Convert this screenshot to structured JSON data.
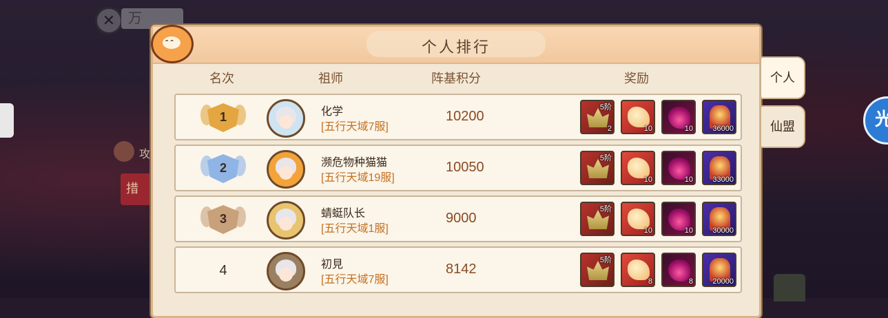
{
  "background": {
    "tab_label": "万",
    "attack_label": "攻",
    "red_button_label": "措",
    "badge_text": "光环"
  },
  "panel": {
    "title": "个人排行"
  },
  "columns": {
    "rank": "名次",
    "ancestor": "祖师",
    "score": "阵基积分",
    "reward": "奖励"
  },
  "side_tabs": [
    {
      "label": "个人",
      "active": true
    },
    {
      "label": "仙盟",
      "active": false
    }
  ],
  "rows": [
    {
      "rank": "1",
      "medal": "gold",
      "name": "化学",
      "server": "[五行天域7服]",
      "score": "10200",
      "rewards": [
        {
          "kind": "gear",
          "tier": "5阶",
          "qty": "2",
          "icon": "crown-gear-icon"
        },
        {
          "kind": "scroll",
          "qty": "10",
          "icon": "scroll-icon"
        },
        {
          "kind": "flame",
          "qty": "10",
          "icon": "purple-flame-icon"
        },
        {
          "kind": "chest",
          "qty": "36000",
          "icon": "treasure-icon"
        }
      ]
    },
    {
      "rank": "2",
      "medal": "silver",
      "name": "濒危物种猫猫",
      "server": "[五行天域19服]",
      "score": "10050",
      "rewards": [
        {
          "kind": "gear",
          "tier": "5阶",
          "qty": "",
          "icon": "crown-gear-icon"
        },
        {
          "kind": "scroll",
          "qty": "10",
          "icon": "scroll-icon"
        },
        {
          "kind": "flame",
          "qty": "10",
          "icon": "purple-flame-icon"
        },
        {
          "kind": "chest",
          "qty": "33000",
          "icon": "treasure-icon"
        }
      ]
    },
    {
      "rank": "3",
      "medal": "bronze",
      "name": "蜻蜓队长",
      "server": "[五行天域1服]",
      "score": "9000",
      "rewards": [
        {
          "kind": "gear",
          "tier": "5阶",
          "qty": "",
          "icon": "crown-gear-icon"
        },
        {
          "kind": "scroll",
          "qty": "10",
          "icon": "scroll-icon"
        },
        {
          "kind": "flame",
          "qty": "10",
          "icon": "purple-flame-icon"
        },
        {
          "kind": "chest",
          "qty": "30000",
          "icon": "treasure-icon"
        }
      ]
    },
    {
      "rank": "4",
      "medal": "none",
      "name": "初見",
      "server": "[五行天域7服]",
      "score": "8142",
      "rewards": [
        {
          "kind": "gear",
          "tier": "5阶",
          "qty": "",
          "icon": "crown-gear-icon"
        },
        {
          "kind": "scroll",
          "qty": "8",
          "icon": "scroll-icon"
        },
        {
          "kind": "flame",
          "qty": "8",
          "icon": "purple-flame-icon"
        },
        {
          "kind": "chest",
          "qty": "20000",
          "icon": "treasure-icon"
        }
      ]
    }
  ],
  "colors": {
    "gold": "#e3a640",
    "silver": "#8fb4e6",
    "bronze": "#c8a07a"
  }
}
